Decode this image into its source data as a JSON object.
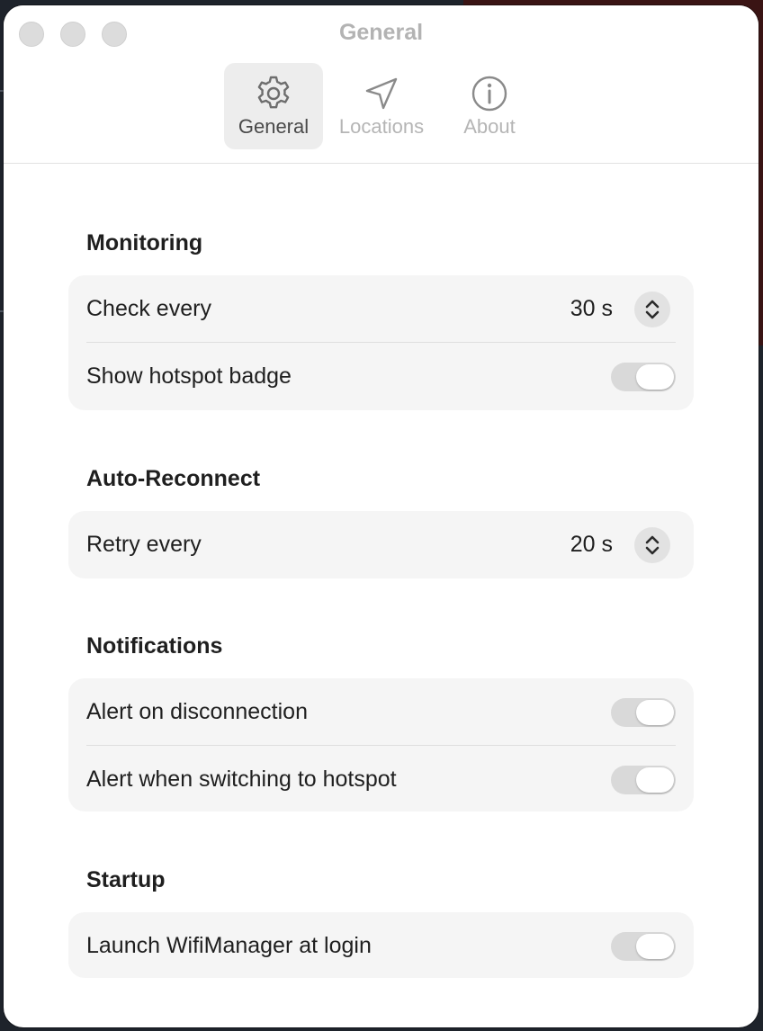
{
  "window": {
    "title": "General"
  },
  "tabs": [
    {
      "label": "General",
      "icon": "gear-icon",
      "active": true
    },
    {
      "label": "Locations",
      "icon": "location-arrow-icon",
      "active": false
    },
    {
      "label": "About",
      "icon": "info-circle-icon",
      "active": false
    }
  ],
  "sections": {
    "monitoring": {
      "title": "Monitoring",
      "check_every": {
        "label": "Check every",
        "value": "30 s"
      },
      "show_badge": {
        "label": "Show hotspot badge"
      }
    },
    "auto_reconnect": {
      "title": "Auto-Reconnect",
      "retry_every": {
        "label": "Retry every",
        "value": "20 s"
      }
    },
    "notifications": {
      "title": "Notifications",
      "alert_disconnect": {
        "label": "Alert on disconnection"
      },
      "alert_hotspot": {
        "label": "Alert when switching to hotspot"
      }
    },
    "startup": {
      "title": "Startup",
      "launch_login": {
        "label": "Launch WifiManager at login"
      }
    }
  },
  "colors": {
    "toggle_off": "#d9d9d9",
    "card_bg": "#f5f5f5",
    "active_tab_bg": "#ededed"
  }
}
